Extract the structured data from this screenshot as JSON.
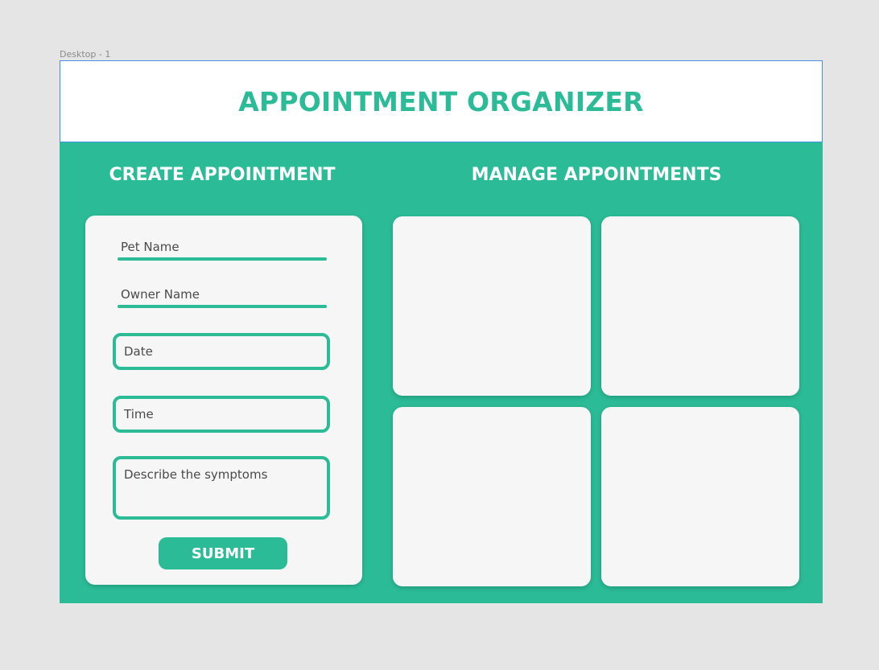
{
  "frame_label": "Desktop - 1",
  "header": {
    "title": "APPOINTMENT ORGANIZER"
  },
  "create": {
    "title": "CREATE APPOINTMENT",
    "fields": {
      "pet_name": "Pet Name",
      "owner_name": "Owner Name",
      "date": "Date",
      "time": "Time",
      "symptoms": "Describe the symptoms"
    },
    "submit_label": "SUBMIT"
  },
  "manage": {
    "title": "MANAGE APPOINTMENTS",
    "cards": [
      "",
      "",
      "",
      ""
    ]
  },
  "colors": {
    "accent": "#2bbb97",
    "card": "#f6f6f6",
    "background": "#e5e5e5",
    "selection": "#4a90e2"
  }
}
